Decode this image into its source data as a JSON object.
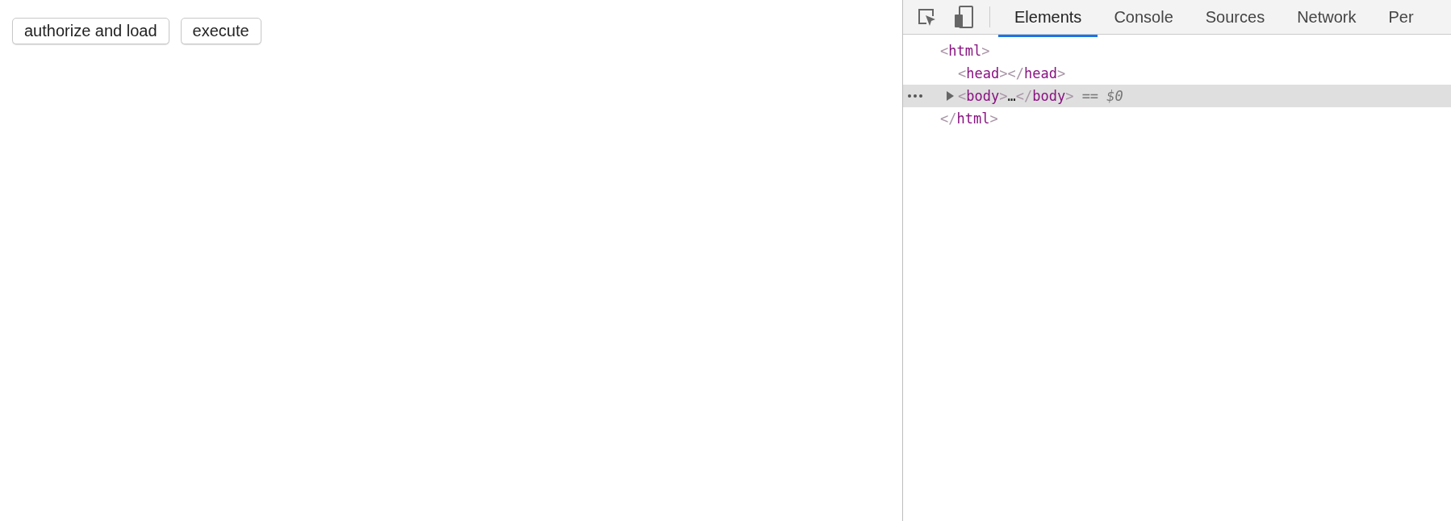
{
  "page": {
    "buttons": [
      {
        "label": "authorize and load"
      },
      {
        "label": "execute"
      }
    ]
  },
  "devtools": {
    "tabs": [
      {
        "label": "Elements",
        "selected": true
      },
      {
        "label": "Console",
        "selected": false
      },
      {
        "label": "Sources",
        "selected": false
      },
      {
        "label": "Network",
        "selected": false
      },
      {
        "label": "Per",
        "selected": false
      }
    ],
    "dom_tree": [
      {
        "selected": false,
        "pieces": [
          {
            "kind": "bracket",
            "text": "<"
          },
          {
            "kind": "tag",
            "text": "html"
          },
          {
            "kind": "bracket",
            "text": ">"
          }
        ],
        "children": [
          {
            "selected": false,
            "pieces": [
              {
                "kind": "bracket",
                "text": "<"
              },
              {
                "kind": "tag",
                "text": "head"
              },
              {
                "kind": "bracket",
                "text": "></"
              },
              {
                "kind": "tag",
                "text": "head"
              },
              {
                "kind": "bracket",
                "text": ">"
              }
            ]
          },
          {
            "selected": true,
            "expanded": false,
            "pieces": [
              {
                "kind": "bracket",
                "text": "<"
              },
              {
                "kind": "tag",
                "text": "body"
              },
              {
                "kind": "bracket",
                "text": ">"
              },
              {
                "kind": "text",
                "text": "…"
              },
              {
                "kind": "bracket",
                "text": "</"
              },
              {
                "kind": "tag",
                "text": "body"
              },
              {
                "kind": "bracket",
                "text": ">"
              },
              {
                "kind": "op",
                "text": " == "
              },
              {
                "kind": "var",
                "text": "$0"
              }
            ]
          }
        ],
        "closing": [
          {
            "kind": "bracket",
            "text": "</"
          },
          {
            "kind": "tag",
            "text": "html"
          },
          {
            "kind": "bracket",
            "text": ">"
          }
        ]
      }
    ]
  }
}
